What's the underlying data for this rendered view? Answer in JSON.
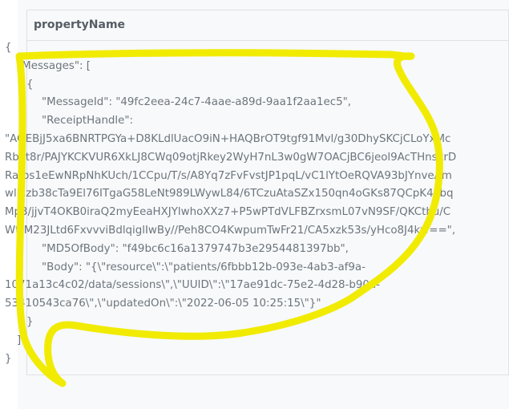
{
  "card": {
    "title": "propertyName"
  },
  "json_lines": [
    {
      "indent": 0,
      "text": "{"
    },
    {
      "indent": 1,
      "text": "\"Messages\": ["
    },
    {
      "indent": 2,
      "text": "{"
    },
    {
      "indent": 3,
      "text": "\"MessageId\": \"49fc2eea-24c7-4aae-a89d-9aa1f2aa1ec5\","
    },
    {
      "indent": 3,
      "text": "\"ReceiptHandle\":"
    },
    {
      "indent": 0,
      "text": "\"AQEBjJ5xa6BNRTPGYa+D8KLdlUacO9iN+HAQBrOT9tgf91Mvl/g30DhySKCjCLoYxMc"
    },
    {
      "indent": 0,
      "text": "Rbvt8r/PAJYKCKVUR6XkLJ8CWq09otjRkey2WyH7nL3w0gW7OACjBC6jeol9AcTHnskrD"
    },
    {
      "indent": 0,
      "text": "Rafps1eEwNRpNhKUch/1CCpu/T/s/A8Yq7zFvFvstJP1pqL/vC1lYtOeRQVA93bJYnveAm"
    },
    {
      "indent": 0,
      "text": "wlMzb38cTa9El76ITgaG58LeNt989LWywL84/6TCzuAtaSZx150qn4oGKs87QCpK4xbq"
    },
    {
      "indent": 0,
      "text": "Mp3/jjvT4OKB0iraQ2myEeaHXJYlwhoXXz7+P5wPTdVLFBZrxsmL07vN9SF/QKCthu/C"
    },
    {
      "indent": 0,
      "text": "WttM23JLtd6FxvvviBdlqiglIwBy//Peh8CO4KwpumTwFr21/CA5xzk53s/yHco8J4kw==\","
    },
    {
      "indent": 3,
      "text": "\"MD5OfBody\": \"f49bc6c16a1379747b3e2954481397bb\","
    },
    {
      "indent": 3,
      "text": "\"Body\": \"{\\\"resource\\\":\\\"patients/6fbbb12b-093e-4ab3-af9a-"
    },
    {
      "indent": 0,
      "text": "1071a13c4c02/data/sessions\\\",\\\"UUID\\\":\\\"17ae91dc-75e2-4d28-b90a-"
    },
    {
      "indent": 0,
      "text": "53410543ca76\\\",\\\"updatedOn\\\":\\\"2022-06-05 10:25:15\\\"}\""
    },
    {
      "indent": 2,
      "text": "}"
    },
    {
      "indent": 1,
      "text": "]"
    },
    {
      "indent": 0,
      "text": "}"
    }
  ],
  "annotation": {
    "color": "#f0eb00"
  }
}
